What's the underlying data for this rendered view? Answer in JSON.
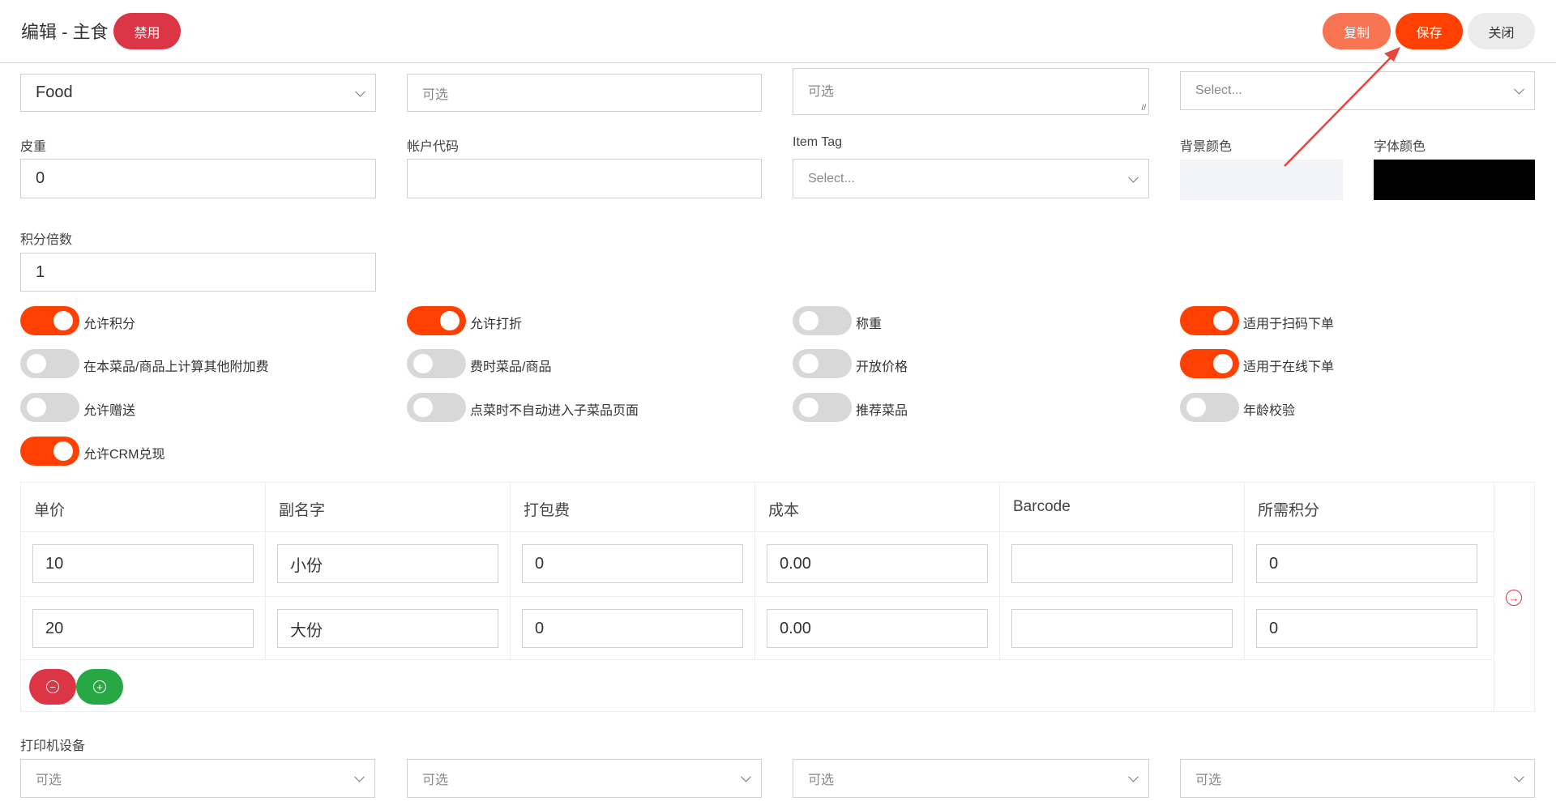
{
  "header": {
    "title": "编辑 - 主食",
    "disabled_badge": "禁用",
    "copy_label": "复制",
    "save_label": "保存",
    "close_label": "关闭"
  },
  "row1": {
    "category_value": "Food",
    "field2_placeholder": "可选",
    "field3_placeholder": "可选",
    "field4_placeholder": "Select..."
  },
  "row2": {
    "tare_label": "皮重",
    "tare_value": "0",
    "account_code_label": "帐户代码",
    "account_code_value": "",
    "item_tag_label": "Item Tag",
    "item_tag_placeholder": "Select...",
    "bg_color_label": "背景颜色",
    "bg_color": "#f2f3f7",
    "font_color_label": "字体颜色",
    "font_color": "#000000"
  },
  "row3": {
    "points_multiplier_label": "积分倍数",
    "points_multiplier_value": "1"
  },
  "toggles": [
    {
      "label": "允许积分",
      "on": true
    },
    {
      "label": "允许打折",
      "on": true
    },
    {
      "label": "称重",
      "on": false
    },
    {
      "label": "适用于扫码下单",
      "on": true
    },
    {
      "label": "在本菜品/商品上计算其他附加费",
      "on": false
    },
    {
      "label": "费时菜品/商品",
      "on": false
    },
    {
      "label": "开放价格",
      "on": false
    },
    {
      "label": "适用于在线下单",
      "on": true
    },
    {
      "label": "允许赠送",
      "on": false
    },
    {
      "label": "点菜时不自动进入子菜品页面",
      "on": false
    },
    {
      "label": "推荐菜品",
      "on": false
    },
    {
      "label": "年龄校验",
      "on": false
    },
    {
      "label": "允许CRM兑现",
      "on": true
    }
  ],
  "table": {
    "headers": [
      "单价",
      "副名字",
      "打包费",
      "成本",
      "Barcode",
      "所需积分"
    ],
    "rows": [
      [
        "10",
        "小份",
        "0",
        "0.00",
        "",
        "0"
      ],
      [
        "20",
        "大份",
        "0",
        "0.00",
        "",
        "0"
      ]
    ]
  },
  "printer": {
    "label": "打印机设备",
    "selects": [
      "可选",
      "可选",
      "可选",
      "可选"
    ]
  },
  "colors": {
    "accent": "#ff4000",
    "copy": "#f97452",
    "danger": "#dc3545",
    "success": "#28a745"
  }
}
